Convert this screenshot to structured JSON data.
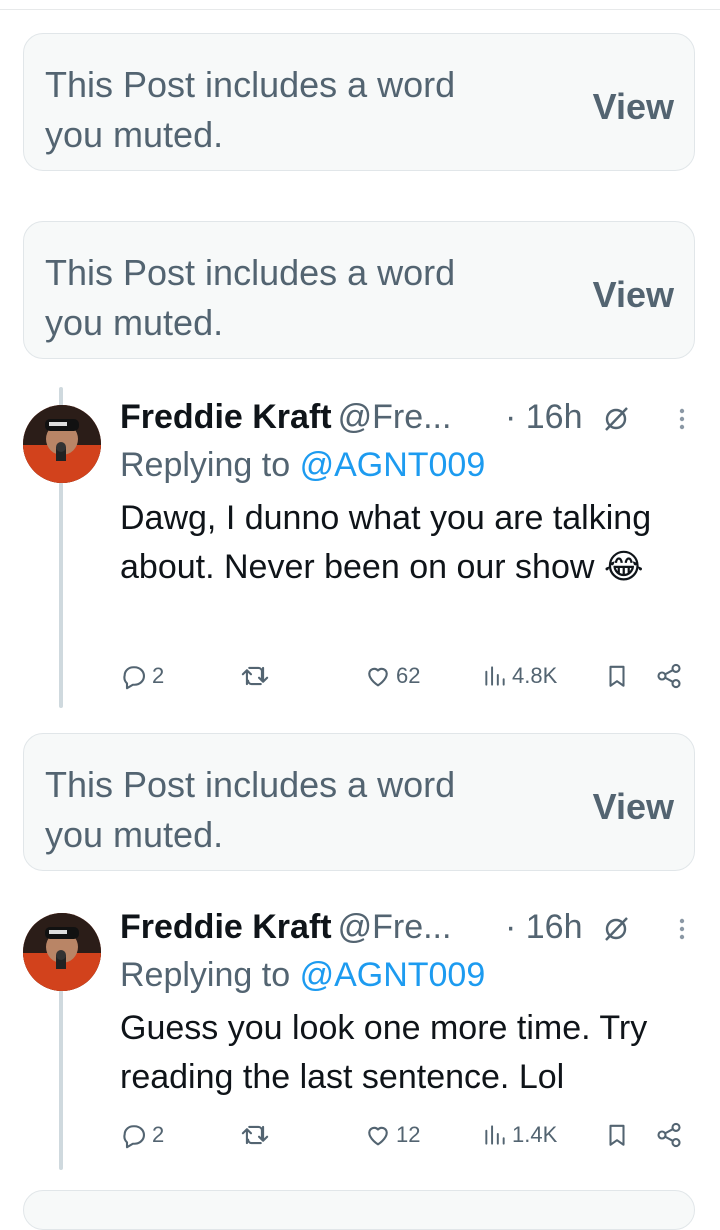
{
  "muted_notice": {
    "text": "This Post includes a word you muted.",
    "view_label": "View"
  },
  "tweets": [
    {
      "display_name": "Freddie Kraft",
      "handle": "@Fre...",
      "time": "· 16h",
      "replying_prefix": "Replying to",
      "replying_to": "@AGNT009",
      "body": "Dawg, I dunno what you are talking about. Never been on our show 😂",
      "replies": "2",
      "reposts": "",
      "likes": "62",
      "views": "4.8K"
    },
    {
      "display_name": "Freddie Kraft",
      "handle": "@Fre...",
      "time": "· 16h",
      "replying_prefix": "Replying to",
      "replying_to": "@AGNT009",
      "body": "Guess you look one more time. Try reading the last sentence. Lol",
      "replies": "2",
      "reposts": "",
      "likes": "12",
      "views": "1.4K"
    }
  ],
  "icons": {
    "reply": "reply-icon",
    "repost": "repost-icon",
    "like": "heart-icon",
    "views": "analytics-icon",
    "bookmark": "bookmark-icon",
    "share": "share-icon",
    "grok": "grok-icon",
    "more": "more-icon"
  },
  "colors": {
    "text": "#0f1419",
    "secondary": "#536471",
    "link": "#1d9bf0",
    "muted_bg": "#f7f9f9",
    "thread_line": "#cfd9de"
  }
}
